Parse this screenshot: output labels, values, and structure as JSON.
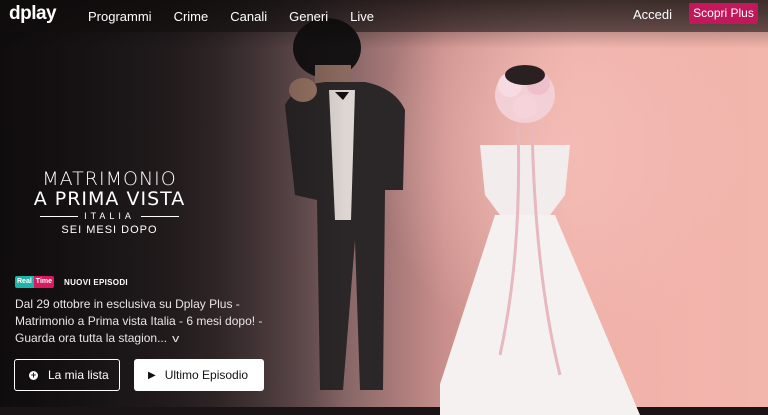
{
  "header": {
    "logo": "dplay",
    "nav": [
      "Programmi",
      "Crime",
      "Canali",
      "Generi",
      "Live"
    ],
    "login_label": "Accedi",
    "cta_label": "Scopri Plus"
  },
  "hero": {
    "title_line1": "MATRIMONIO",
    "title_line2": "A PRIMA VISTA",
    "title_line3": "ITALIA",
    "title_line4": "SEI MESI DOPO",
    "channel_badge_a": "Real",
    "channel_badge_b": "Time",
    "tag": "NUOVI EPISODI",
    "description": "Dal 29 ottobre in esclusiva su Dplay Plus - Matrimonio a Prima vista Italia - 6 mesi dopo! - Guarda ora tutta la stagion...",
    "expand_icon": "chevron-down-icon",
    "my_list_label": "La mia lista",
    "latest_episode_label": "Ultimo Episodio"
  },
  "colors": {
    "cta": "#c2185b",
    "badge_teal": "#1db5a7",
    "badge_pink": "#d81b60"
  }
}
